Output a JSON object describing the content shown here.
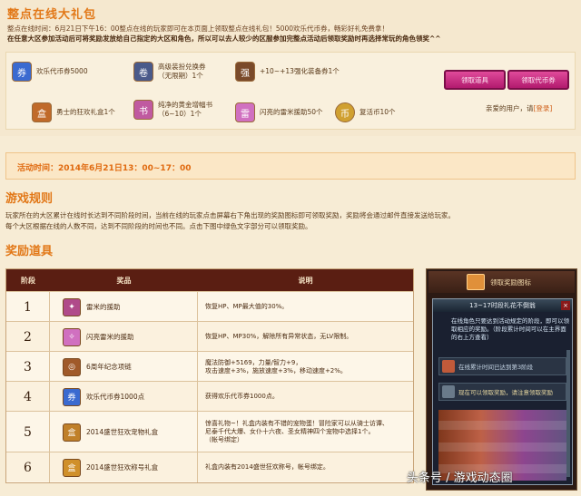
{
  "top": {
    "title": "整点在线大礼包",
    "line1": "整点在线时间：6月21日下午16：00整点在线的玩家即可在本页面上领取整点在线礼包！5000欢乐代币券，畅彩好礼免费拿！",
    "line2": "在任意大区参加活动后可将奖励发放给自己指定的大区和角色，所以可以去人较少的区服参加完整点活动后领取奖励时再选择常玩的角色领奖^^",
    "rewards": [
      {
        "label": "欢乐代币券5000",
        "icon": "coupon-icon",
        "color": "#3a6ad0"
      },
      {
        "label": "高级装扮兑换券\n（无限期）1个",
        "icon": "avatar-ticket-icon",
        "color": "#4a5a8a"
      },
      {
        "label": "+10~+13强化装备券1个",
        "icon": "enhance-ticket-icon",
        "color": "#7a4a2a"
      },
      {
        "label": "勇士的狂欢礼盒1个",
        "icon": "gift-box-icon",
        "color": "#c06a2a"
      },
      {
        "label": "纯净的黄金增幅书\n（6~10）1个",
        "icon": "gold-book-icon",
        "color": "#c05aa0"
      },
      {
        "label": "闪亮的雷米援助50个",
        "icon": "remy-aid-icon",
        "color": "#d070c0"
      },
      {
        "label": "复活币10个",
        "icon": "revive-coin-icon",
        "color": "#d0a030"
      }
    ],
    "claim_items_label": "领取道具",
    "claim_coupon_label": "领取代币券",
    "login_prefix": "亲爱的用户，请",
    "login_link": "[登录]"
  },
  "time": {
    "label": "活动时间：2014年6月21日13：00~17：00"
  },
  "rules": {
    "title": "游戏规则",
    "line1": "玩家所在的大区累计在线时长达到不同阶段时间，当前在线的玩家点击屏幕右下角出现的奖励图标即可领取奖励，奖励将会通过邮件直接发送给玩家。",
    "line2": "每个大区根据在线的人数不同，达到不同阶段的时间也不同。点击下图中绿色文字部分可以领取奖励。"
  },
  "items": {
    "title": "奖励道具",
    "headers": [
      "阶段",
      "奖品",
      "说明"
    ],
    "rows": [
      {
        "stage": "1",
        "name": "雷米的援助",
        "icon_color": "#b04a8a",
        "desc": [
          "恢复HP、MP最大值的30%。"
        ]
      },
      {
        "stage": "2",
        "name": "闪亮雷米的援助",
        "icon_color": "#d070c0",
        "desc": [
          "恢复HP、MP30%，解除所有异常状态，无LV限制。"
        ]
      },
      {
        "stage": "3",
        "name": "6周年纪念项链",
        "icon_color": "#a05a2a",
        "desc": [
          "魔法防御+5169，力量/智力+9，",
          "攻击速度+3%，施放速度+3%，移动速度+2%。"
        ]
      },
      {
        "stage": "4",
        "name": "欢乐代币券1000点",
        "icon_color": "#3a6ad0",
        "desc": [
          "获得欢乐代币券1000点。"
        ]
      },
      {
        "stage": "5",
        "name": "2014盛世狂欢宠物礼盒",
        "icon_color": "#c0802a",
        "desc": [
          "惊喜礼物~！礼盒内装有不错的宠物蛋！冒险家可以从骑士访谭、",
          "尼泰千代大爆、女仆十六夜、圣女精神四个宠物中选择1个。",
          "（帐号绑定）"
        ]
      },
      {
        "stage": "6",
        "name": "2014盛世狂欢称号礼盒",
        "icon_color": "#d0902a",
        "desc": [
          "礼盒内装有2014盛世狂欢称号，帐号绑定。"
        ]
      }
    ]
  },
  "side": {
    "header_label": "领取奖励图标",
    "popup_title": "13~17时段礼花不倒翁",
    "popup_desc": "在线角色只要达到活动规定的阶段，即可以领取相应的奖励。（阶段累计时间可以在主界面的右上方查看）",
    "row1": "在线累计时间已达到第3阶段",
    "row2": "现在可以领取奖励，请注意领取奖励",
    "close": "×"
  },
  "watermark": "头条号 / 游戏动态圈"
}
